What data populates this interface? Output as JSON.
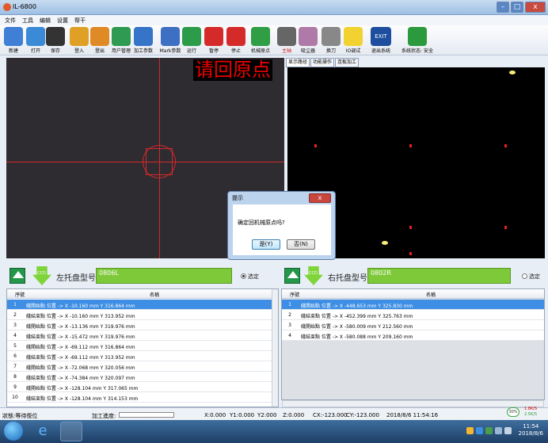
{
  "window": {
    "title": "IL-6800"
  },
  "menu": [
    "文件",
    "工具",
    "编辑",
    "设置",
    "帮干"
  ],
  "toolbar": [
    {
      "label": "新建",
      "icon": "new-file-icon",
      "color": "#3f7fd6"
    },
    {
      "label": "打开",
      "icon": "open-folder-icon",
      "color": "#3a8ad8"
    },
    {
      "label": "保存",
      "icon": "save-icon",
      "color": "#333"
    },
    {
      "label": "登入",
      "icon": "login-icon",
      "color": "#e0a026"
    },
    {
      "label": "登出",
      "icon": "logout-icon",
      "color": "#e08a26"
    },
    {
      "label": "用户管理",
      "icon": "users-icon",
      "color": "#2e9a52"
    },
    {
      "label": "加工参数",
      "icon": "parameters-icon",
      "color": "#3574c8"
    },
    {
      "label": "Mark参数",
      "icon": "mark-pencil-icon",
      "color": "#3d6fc2"
    },
    {
      "label": "运行",
      "icon": "play-icon",
      "color": "#2c9b4a"
    },
    {
      "label": "暂停",
      "icon": "pause-icon",
      "color": "#d52a2a"
    },
    {
      "label": "停止",
      "icon": "stop-icon",
      "color": "#d52a2a"
    },
    {
      "label": "机械原点",
      "icon": "home-origin-icon",
      "color": "#2f9e45"
    },
    {
      "label": "主轴",
      "icon": "spindle-icon",
      "color": "#666",
      "red": true
    },
    {
      "label": "吸尘器",
      "icon": "vacuum-icon",
      "color": "#b07aa8"
    },
    {
      "label": "换刀",
      "icon": "tool-change-icon",
      "color": "#888"
    },
    {
      "label": "IO调试",
      "icon": "lightbulb-icon",
      "color": "#f2d230"
    },
    {
      "label": "退出系统",
      "icon": "exit-icon",
      "color": "#1d4f9e",
      "text": "EXIT"
    },
    {
      "label": "系统状态: 安全",
      "icon": "shield-check-icon",
      "color": "#2b9a3c"
    }
  ],
  "camera": {
    "message": "请回原点"
  },
  "tabs": [
    "显示路径",
    "功能操作",
    "连板加工"
  ],
  "left_panel": {
    "ccd": "CCD",
    "label": "左托盘型号:",
    "model": "0806L",
    "select_label": "选定",
    "selected": true
  },
  "right_panel": {
    "ccd": "CCD",
    "label": "右托盘型号:",
    "model": "0802R",
    "select_label": "选定",
    "selected": false
  },
  "columns": {
    "index": "序號",
    "name": "名稱"
  },
  "left_rows": [
    {
      "n": "1",
      "text": "綫開始點   位置 -> X -10.160 mm   Y 316.864 mm"
    },
    {
      "n": "2",
      "text": "綫結束點   位置 -> X -10.160 mm   Y 313.952 mm"
    },
    {
      "n": "3",
      "text": "綫開始點   位置 -> X -13.136 mm   Y 319.976 mm"
    },
    {
      "n": "4",
      "text": "綫結束點   位置 -> X -15.472 mm   Y 319.976 mm"
    },
    {
      "n": "5",
      "text": "綫開始點   位置 -> X -69.112 mm   Y 316.864 mm"
    },
    {
      "n": "6",
      "text": "綫結束點   位置 -> X -69.112 mm   Y 313.952 mm"
    },
    {
      "n": "7",
      "text": "綫開始點   位置 -> X -72.068 mm   Y 320.056 mm"
    },
    {
      "n": "8",
      "text": "綫結束點   位置 -> X -74.384 mm   Y 320.097 mm"
    },
    {
      "n": "9",
      "text": "綫開始點   位置 -> X -128.104 mm   Y 317.065 mm"
    },
    {
      "n": "10",
      "text": "綫結束點   位置 -> X -128.104 mm   Y 314.153 mm"
    }
  ],
  "right_rows": [
    {
      "n": "1",
      "text": "綫開始點   位置 -> X -448.653 mm   Y 325.830 mm"
    },
    {
      "n": "2",
      "text": "綫結束點   位置 -> X -452.399 mm   Y 325.763 mm"
    },
    {
      "n": "3",
      "text": "綫開始點   位置 -> X -580.009 mm   Y 212.560 mm"
    },
    {
      "n": "4",
      "text": "綫結束點   位置 -> X -580.088 mm   Y 209.160 mm"
    }
  ],
  "status": {
    "state": "狀態:等待復位",
    "progress_label": "加工進度:",
    "x": "X:0.000",
    "y1": "Y1:0.000",
    "y2": "Y2:000",
    "z": "Z:0.000",
    "cx": "CX:-123.000",
    "cy": "CY:-123.000",
    "datetime": "2018/8/6 11:54:16"
  },
  "speed": {
    "percent": "30%",
    "up": "1.8K/S",
    "down": "2.5K/S"
  },
  "dialog": {
    "title": "提示",
    "message": "确定回机械原点吗?",
    "yes": "是(Y)",
    "no": "否(N)",
    "close": "x"
  },
  "clock": {
    "time": "11:54",
    "date": "2018/8/6"
  }
}
